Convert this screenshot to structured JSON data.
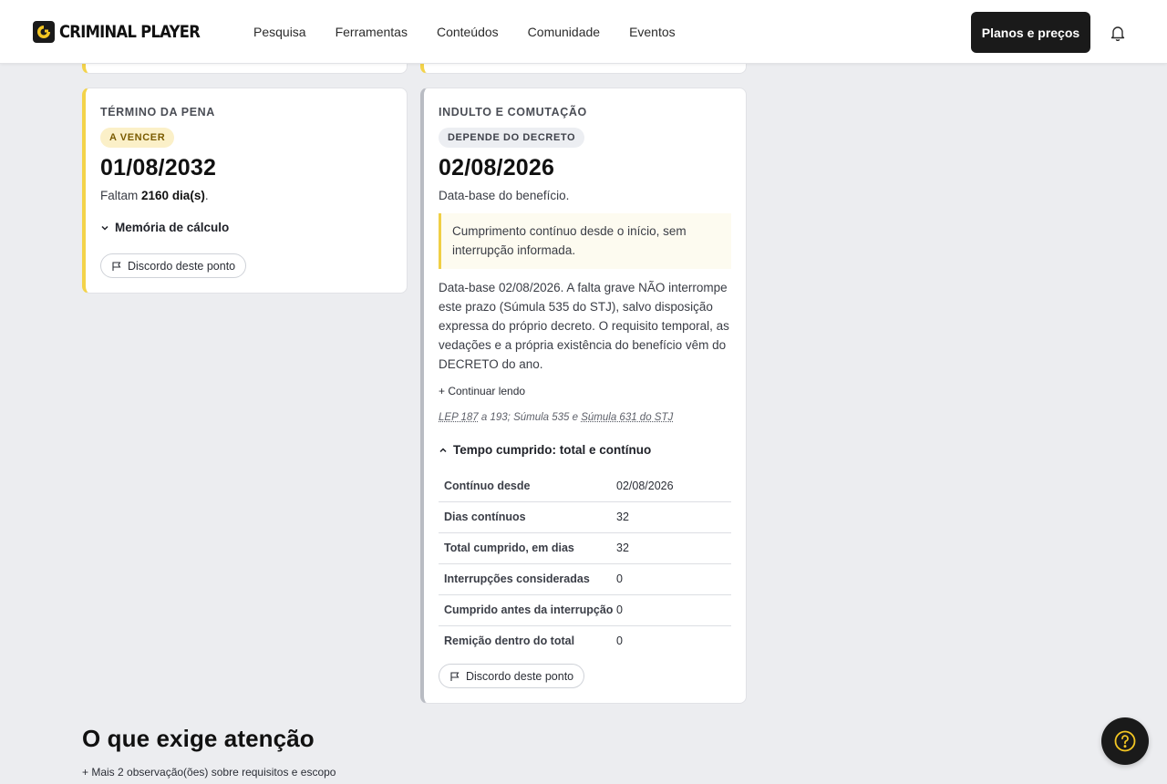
{
  "header": {
    "brand": "CRIMINAL PLAYER",
    "nav": [
      "Pesquisa",
      "Ferramentas",
      "Conteúdos",
      "Comunidade",
      "Eventos"
    ],
    "cta": "Planos e preços",
    "icons": {
      "logo": "criminal-player-logo",
      "notifications": "bell-icon"
    },
    "accent_color": "#f3d34a"
  },
  "card_end": {
    "title": "TÉRMINO DA PENA",
    "badge": "A VENCER",
    "date": "01/08/2032",
    "remaining_prefix": "Faltam",
    "remaining_days": "2160 dia(s)",
    "remaining_suffix": ".",
    "calc_toggle": "Memória de cálculo",
    "disagree": "Discordo deste ponto"
  },
  "card_pardon": {
    "title": "INDULTO E COMUTAÇÃO",
    "badge": "DEPENDE DO DECRETO",
    "date": "02/08/2026",
    "subtitle": "Data-base do benefício.",
    "callout": "Cumprimento contínuo desde o início, sem interrupção informada.",
    "body": "Data-base 02/08/2026. A falta grave NÃO interrompe este prazo (Súmula 535 do STJ), salvo disposição expressa do próprio decreto. O requisito temporal, as vedações e a própria existência do benefício vêm do DECRETO do ano.",
    "continue": "+ Continuar lendo",
    "refs": {
      "lep": "LEP 187",
      "mid": " a 193; Súmula 535 e ",
      "sumula": "Súmula 631 do STJ"
    },
    "table_toggle": "Tempo cumprido: total e contínuo",
    "table": [
      {
        "label": "Contínuo desde",
        "value": "02/08/2026"
      },
      {
        "label": "Dias contínuos",
        "value": "32"
      },
      {
        "label": "Total cumprido, em dias",
        "value": "32"
      },
      {
        "label": "Interrupções consideradas",
        "value": "0"
      },
      {
        "label": "Cumprido antes da interrupção",
        "value": "0"
      },
      {
        "label": "Remição dentro do total",
        "value": "0"
      }
    ],
    "disagree": "Discordo deste ponto"
  },
  "attention": {
    "title": "O que exige atenção",
    "more": "+ Mais 2 observação(ões) sobre requisitos e escopo"
  },
  "help": {
    "icon": "help-question-icon"
  }
}
